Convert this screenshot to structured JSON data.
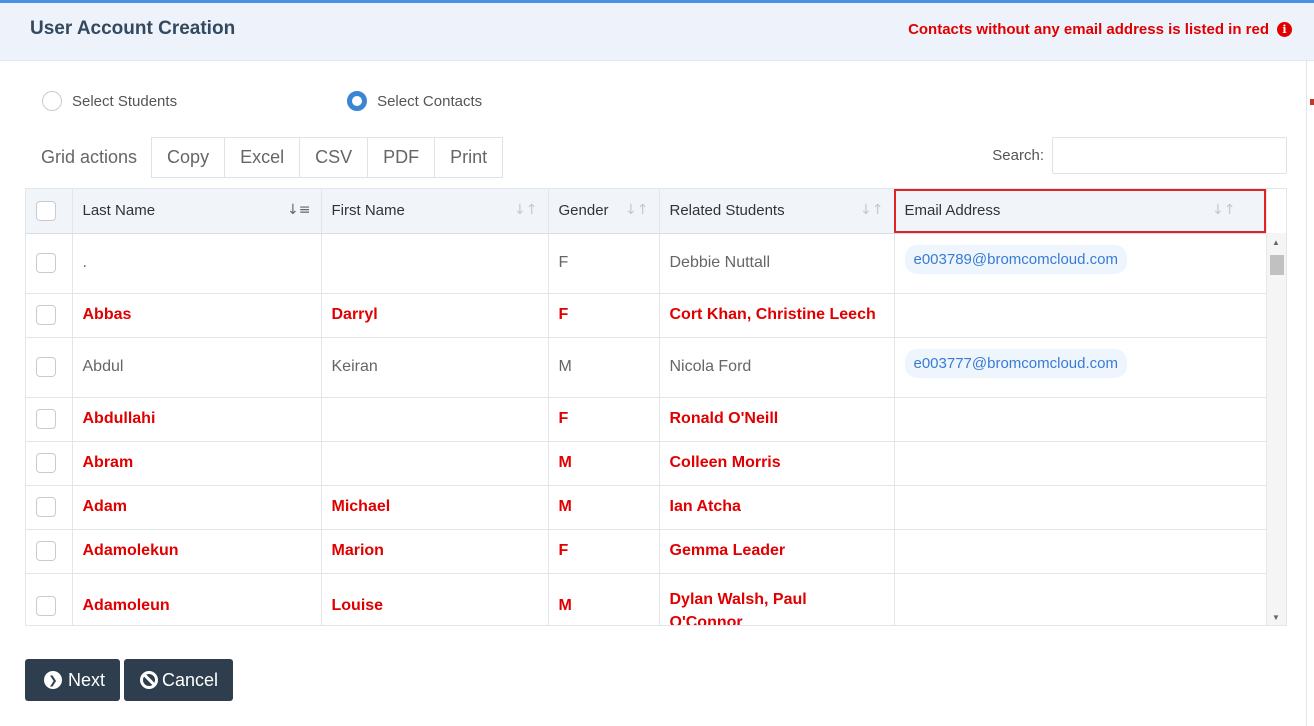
{
  "modal": {
    "title": "User Account Creation",
    "notice": "Contacts without any email address is listed in red",
    "notice_icon": "info-circle-icon"
  },
  "radios": {
    "students_label": "Select Students",
    "contacts_label": "Select Contacts",
    "selected": "contacts"
  },
  "grid_actions": {
    "label": "Grid actions",
    "copy": "Copy",
    "excel": "Excel",
    "csv": "CSV",
    "pdf": "PDF",
    "print": "Print"
  },
  "search": {
    "label": "Search:",
    "value": ""
  },
  "table": {
    "columns": {
      "last_name": "Last Name",
      "first_name": "First Name",
      "gender": "Gender",
      "related_students": "Related Students",
      "email": "Email Address"
    },
    "rows": [
      {
        "last": ".",
        "first": "",
        "gender": "F",
        "related": "Debbie Nuttall",
        "email": "e003789@bromcomcloud.com",
        "no_email": false
      },
      {
        "last": "Abbas",
        "first": "Darryl",
        "gender": "F",
        "related": "Cort Khan, Christine Leech",
        "email": "",
        "no_email": true
      },
      {
        "last": "Abdul",
        "first": "Keiran",
        "gender": "M",
        "related": "Nicola Ford",
        "email": "e003777@bromcomcloud.com",
        "no_email": false
      },
      {
        "last": "Abdullahi",
        "first": "",
        "gender": "F",
        "related": "Ronald O'Neill",
        "email": "",
        "no_email": true
      },
      {
        "last": "Abram",
        "first": "",
        "gender": "M",
        "related": "Colleen Morris",
        "email": "",
        "no_email": true
      },
      {
        "last": "Adam",
        "first": "Michael",
        "gender": "M",
        "related": "Ian Atcha",
        "email": "",
        "no_email": true
      },
      {
        "last": "Adamolekun",
        "first": "Marion",
        "gender": "F",
        "related": "Gemma Leader",
        "email": "",
        "no_email": true
      },
      {
        "last": "Adamoleun",
        "first": "Louise",
        "gender": "M",
        "related": "Dylan Walsh, Paul O'Connor",
        "email": "",
        "no_email": true
      }
    ]
  },
  "footer": {
    "next": "Next",
    "cancel": "Cancel"
  },
  "colors": {
    "no_email_red": "#e00000",
    "email_link": "#3a7bd5",
    "button_dark": "#2f3e4e",
    "radio_selected": "#3a86d4"
  }
}
